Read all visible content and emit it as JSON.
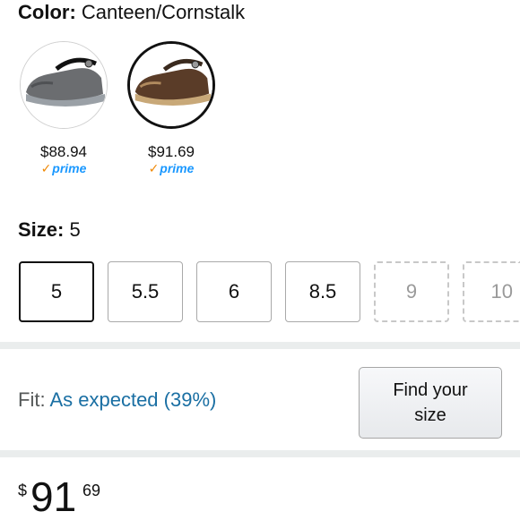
{
  "color": {
    "label": "Color:",
    "value": "Canteen/Cornstalk"
  },
  "swatches": [
    {
      "price": "$88.94",
      "prime": "prime",
      "color_body": "#6b6d70",
      "color_sole": "#9aa0a6"
    },
    {
      "price": "$91.69",
      "prime": "prime",
      "color_body": "#5a3c28",
      "color_sole": "#c8a878"
    }
  ],
  "size": {
    "label": "Size:",
    "value": "5",
    "options": [
      "5",
      "5.5",
      "6",
      "8.5",
      "9",
      "10"
    ]
  },
  "fit": {
    "label": "Fit:",
    "value": "As expected (39%)"
  },
  "find_size_button": "Find your size",
  "price": {
    "symbol": "$",
    "whole": "91",
    "fraction": "69"
  },
  "colors": {
    "link": "#1a6fa3",
    "prime_blue": "#1a98ff",
    "prime_check": "#f08804"
  }
}
